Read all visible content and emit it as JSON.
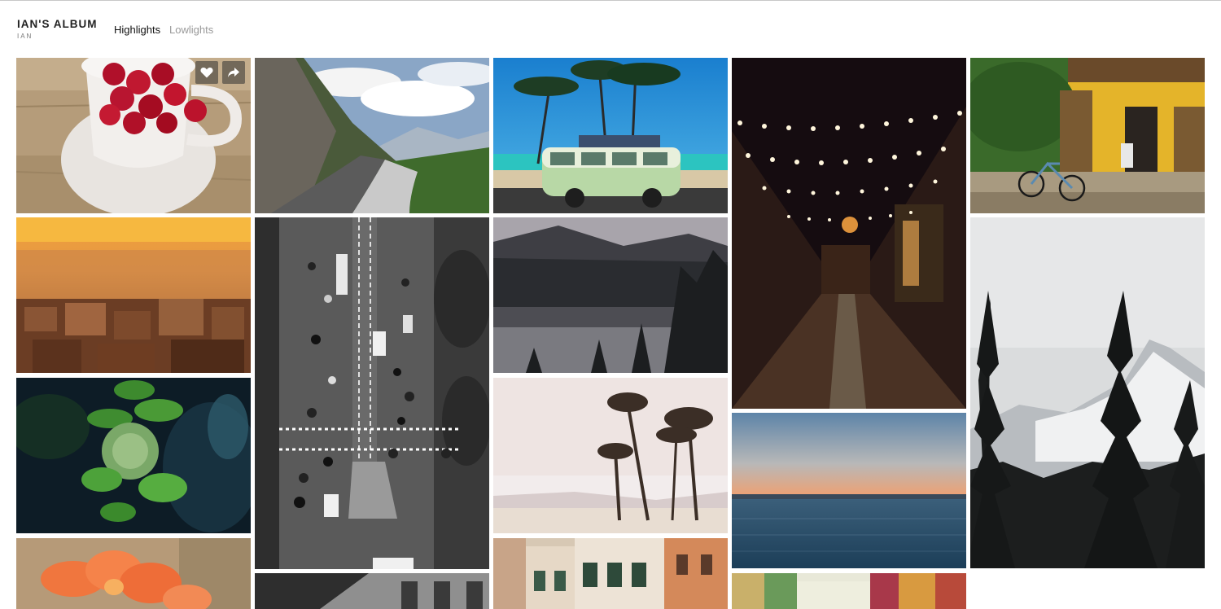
{
  "album": {
    "title": "IAN'S ALBUM",
    "owner": "IAN"
  },
  "nav": {
    "items": [
      {
        "label": "Highlights",
        "active": true
      },
      {
        "label": "Lowlights",
        "active": false
      }
    ]
  },
  "photo_actions": {
    "like_icon": "heart-icon",
    "share_icon": "share-arrow-icon"
  },
  "photos": [
    {
      "id": "raspberries-cup"
    },
    {
      "id": "mountain-road"
    },
    {
      "id": "palm-beach-van"
    },
    {
      "id": "night-street-lights"
    },
    {
      "id": "yellow-house-bicycle"
    },
    {
      "id": "sunset-city"
    },
    {
      "id": "aerial-traffic"
    },
    {
      "id": "misty-lake"
    },
    {
      "id": "snowy-mountain-pines"
    },
    {
      "id": "green-plant"
    },
    {
      "id": "palm-trees-beach"
    },
    {
      "id": "ocean-sunset"
    },
    {
      "id": "orange-flower"
    },
    {
      "id": "bw-building"
    },
    {
      "id": "colorful-buildings"
    },
    {
      "id": "street-houses"
    }
  ]
}
